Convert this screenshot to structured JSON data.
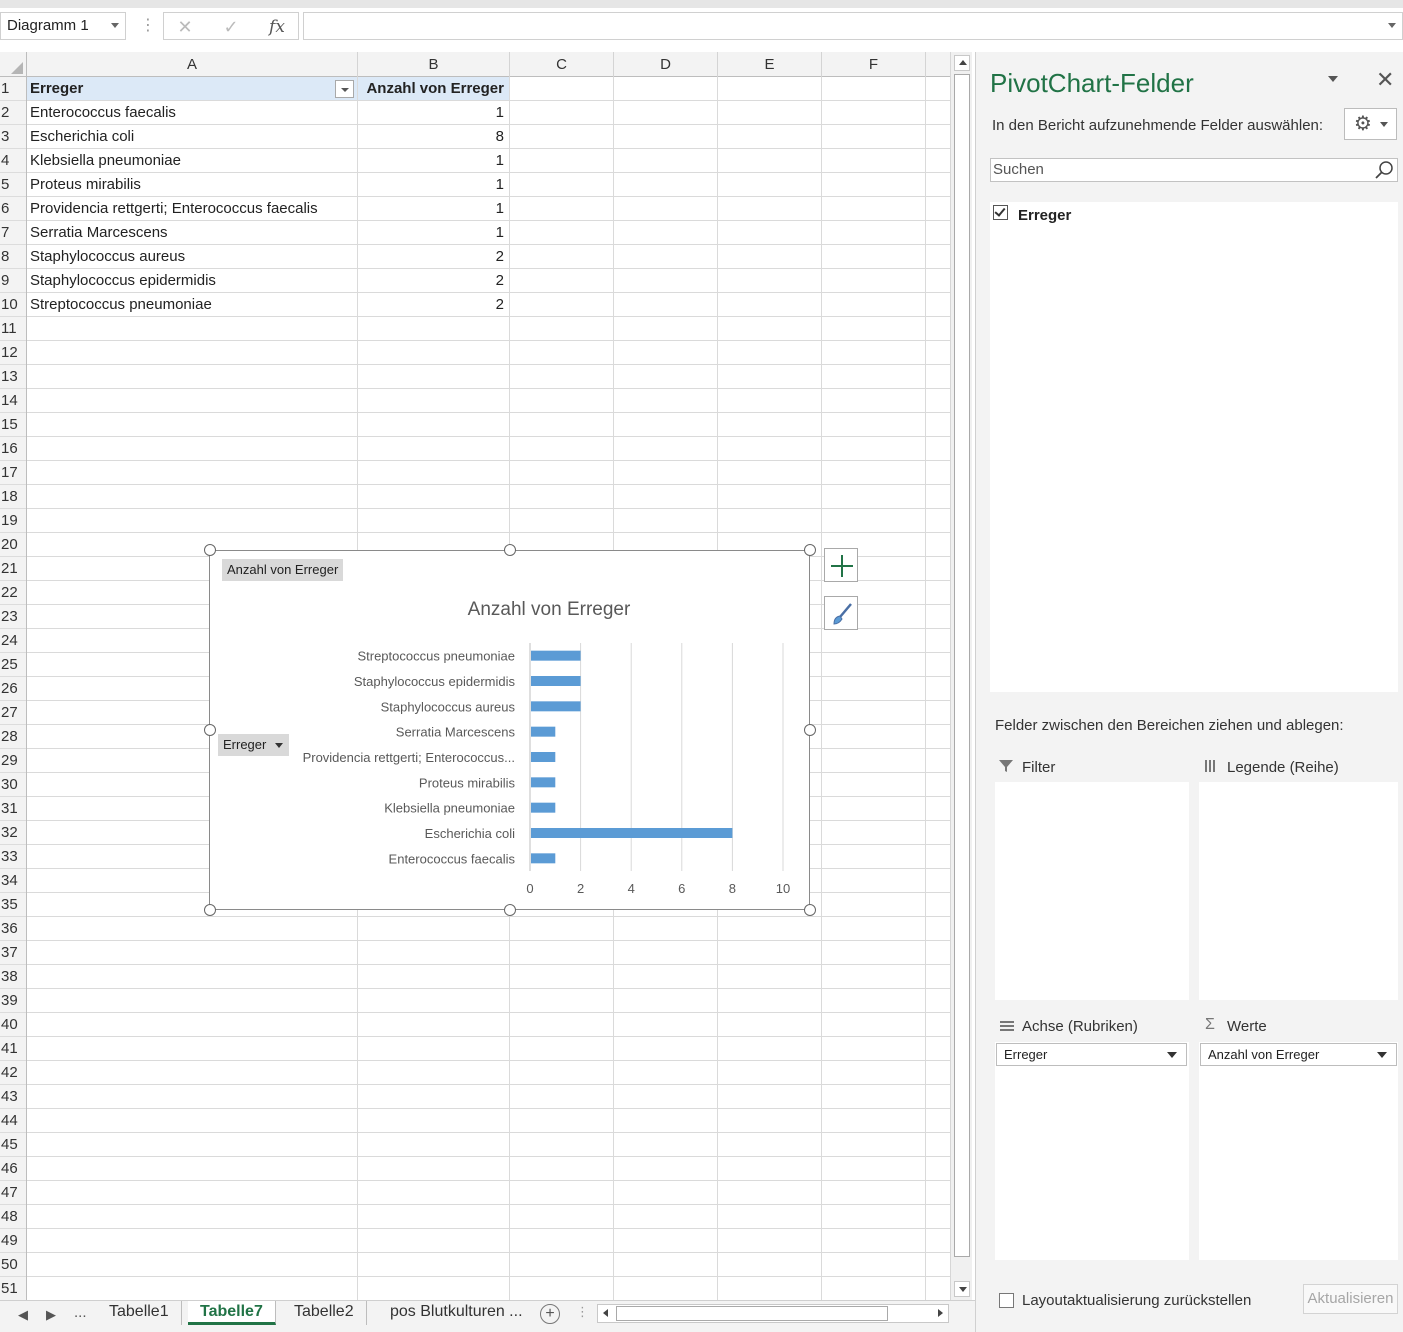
{
  "formula_bar": {
    "name_box": "Diagramm 1",
    "cancel_glyph": "✕",
    "enter_glyph": "✓",
    "fx_label": "fx",
    "formula": ""
  },
  "sheet": {
    "columns": [
      "A",
      "B",
      "C",
      "D",
      "E",
      "F"
    ],
    "rows": [
      "1",
      "2",
      "3",
      "4",
      "5",
      "6",
      "7",
      "8",
      "9",
      "10",
      "11",
      "12",
      "13",
      "14",
      "15",
      "16",
      "17",
      "18",
      "19",
      "20",
      "21",
      "22",
      "23",
      "24",
      "25",
      "26",
      "27",
      "28",
      "29",
      "30",
      "31",
      "32",
      "33",
      "34",
      "35",
      "36",
      "37",
      "38",
      "39",
      "40",
      "41",
      "42",
      "43",
      "44",
      "45",
      "46",
      "47",
      "48",
      "49",
      "50",
      "51"
    ],
    "pivot_header": {
      "a": "Erreger",
      "b": "Anzahl von Erreger"
    },
    "pivot_rows": [
      {
        "a": "Enterococcus faecalis",
        "b": "1"
      },
      {
        "a": "Escherichia coli",
        "b": "8"
      },
      {
        "a": "Klebsiella pneumoniae",
        "b": "1"
      },
      {
        "a": "Proteus mirabilis",
        "b": "1"
      },
      {
        "a": "Providencia rettgerti; Enterococcus faecalis",
        "b": "1"
      },
      {
        "a": "Serratia Marcescens",
        "b": "1"
      },
      {
        "a": "Staphylococcus aureus",
        "b": "2"
      },
      {
        "a": "Staphylococcus epidermidis",
        "b": "2"
      },
      {
        "a": "Streptococcus pneumoniae",
        "b": "2"
      }
    ]
  },
  "chart": {
    "field_button": "Anzahl von Erreger",
    "axis_field_button": "Erreger",
    "bar_color": "#5b9bd5"
  },
  "chart_data": {
    "type": "bar",
    "orientation": "horizontal",
    "title": "Anzahl von Erreger",
    "categories": [
      "Enterococcus faecalis",
      "Escherichia coli",
      "Klebsiella pneumoniae",
      "Proteus mirabilis",
      "Providencia rettgerti; Enterococcus...",
      "Serratia Marcescens",
      "Staphylococcus aureus",
      "Staphylococcus epidermidis",
      "Streptococcus pneumoniae"
    ],
    "values": [
      1,
      8,
      1,
      1,
      1,
      1,
      2,
      2,
      2
    ],
    "xlim": [
      0,
      10
    ],
    "xticks": [
      0,
      2,
      4,
      6,
      8,
      10
    ],
    "grid": true,
    "legend": "none"
  },
  "tabs": {
    "ellipsis": "...",
    "items": [
      "Tabelle1",
      "Tabelle7",
      "Tabelle2",
      "pos Blutkulturen ..."
    ],
    "active_index": 1
  },
  "pane": {
    "title": "PivotChart-Felder",
    "subtitle": "In den Bericht aufzunehmende Felder auswählen:",
    "search_placeholder": "Suchen",
    "fields": [
      {
        "label": "Erreger",
        "checked": true
      }
    ],
    "drag_hint": "Felder zwischen den Bereichen ziehen und ablegen:",
    "areas": {
      "filter": {
        "label": "Filter",
        "items": []
      },
      "legend": {
        "label": "Legende (Reihe)",
        "items": []
      },
      "axis": {
        "label": "Achse (Rubriken)",
        "items": [
          "Erreger"
        ]
      },
      "values": {
        "label": "Werte",
        "items": [
          "Anzahl von Erreger"
        ]
      }
    },
    "defer_label": "Layoutaktualisierung zurückstellen",
    "update_button": "Aktualisieren"
  }
}
